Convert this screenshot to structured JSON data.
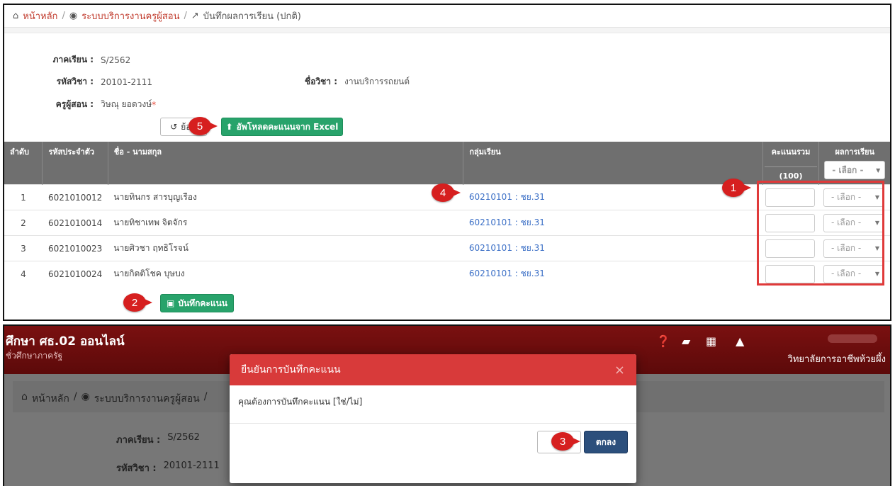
{
  "breadcrumb": {
    "home": "หน้าหลัก",
    "service": "ระบบบริการงานครูผู้สอน",
    "current": "บันทึกผลการเรียน (ปกติ)"
  },
  "info": {
    "term_label": "ภาคเรียน :",
    "term_value": "S/2562",
    "code_label": "รหัสวิชา :",
    "code_value": "20101-2111",
    "subject_label": "ชื่อวิชา :",
    "subject_value": "งานบริการรถยนต์",
    "teacher_label": "ครูผู้สอน :",
    "teacher_value": "วิษณุ ยอดวงษ์",
    "required_mark": "*"
  },
  "buttons": {
    "back_label": "ย้อน",
    "upload_label": "อัพโหลดคะแนนจาก Excel",
    "save_label": "บันทึกคะแนน"
  },
  "table": {
    "headers": {
      "no": "ลำดับ",
      "student_id": "รหัสประจำตัว",
      "name": "ชื่อ - นามสกุล",
      "group": "กลุ่มเรียน",
      "score": "คะแนนรวม",
      "score_max": "(100)",
      "result": "ผลการเรียน"
    },
    "select_placeholder": "- เลือก -",
    "rows": [
      {
        "no": "1",
        "id": "6021010012",
        "name": "นายทินกร สารบุญเรือง",
        "group": "60210101 : ชย.31"
      },
      {
        "no": "2",
        "id": "6021010014",
        "name": "นายทิชาเทพ จิตจักร",
        "group": "60210101 : ชย.31"
      },
      {
        "no": "3",
        "id": "6021010023",
        "name": "นายศิวชา ฤทธิโรจน์",
        "group": "60210101 : ชย.31"
      },
      {
        "no": "4",
        "id": "6021010024",
        "name": "นายกิตติโชค บุษบง",
        "group": "60210101 : ชย.31"
      }
    ]
  },
  "markers": [
    "1",
    "2",
    "3",
    "4",
    "5"
  ],
  "app": {
    "title": "ศึกษา ศธ.02 ออนไลน์",
    "subtitle": "ชั่วศึกษาภาครัฐ",
    "college": "วิทยาลัยการอาชีพห้วยผึ้ง"
  },
  "modal": {
    "title": "ยืนยันการบันทึกคะแนน",
    "message": "คุณต้องการบันทึกคะแนน [ใช่/ไม่]",
    "ok_label": "ตกลง",
    "close_glyph": "×"
  },
  "colors": {
    "accent_red": "#d61f1f",
    "green_button": "#28a36b",
    "header_maroon": "#7a1010",
    "link_blue": "#3b6fc6"
  }
}
